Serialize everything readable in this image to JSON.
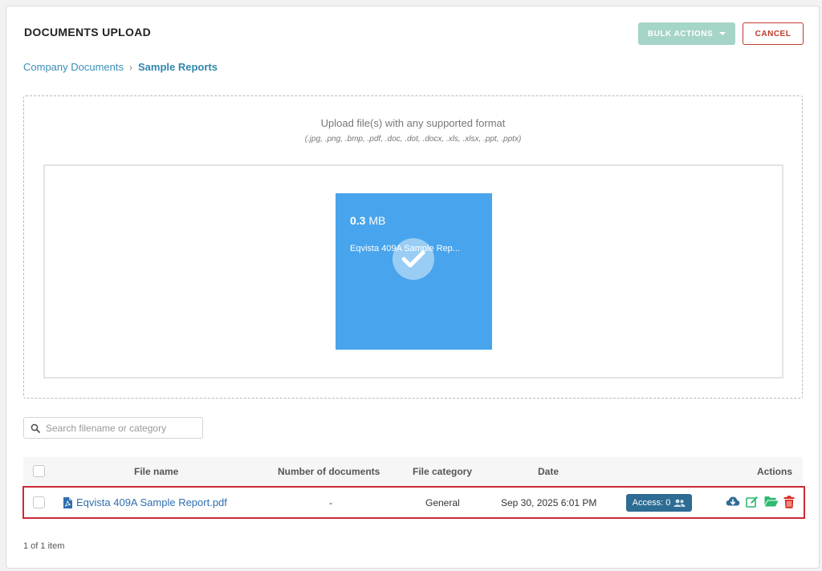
{
  "header": {
    "title": "DOCUMENTS UPLOAD",
    "bulk_actions_label": "BULK ACTIONS",
    "cancel_label": "CANCEL"
  },
  "breadcrumb": {
    "parent": "Company Documents",
    "current": "Sample Reports"
  },
  "dropzone": {
    "hint": "Upload file(s) with any supported format",
    "formats": "(.jpg, .png, .bmp, .pdf, .doc, .dot, .docx, .xls, .xlsx, .ppt, .pptx)",
    "preview": {
      "size_value": "0.3",
      "size_unit": "MB",
      "file_name": "Eqvista 409A Sample Rep..."
    }
  },
  "search": {
    "placeholder": "Search filename or category"
  },
  "table": {
    "columns": {
      "file_name": "File name",
      "num_documents": "Number of documents",
      "file_category": "File category",
      "date": "Date",
      "actions": "Actions"
    },
    "rows": [
      {
        "file_name": "Eqvista 409A Sample Report.pdf",
        "num_documents": "-",
        "file_category": "General",
        "date": "Sep 30, 2025 6:01 PM",
        "access_label": "Access: 0"
      }
    ]
  },
  "footer": {
    "pagination": "1 of 1 item"
  },
  "colors": {
    "accent": "#3a8fb7",
    "tile": "#48a4ec",
    "danger": "#c0392b",
    "success": "#2eb872",
    "badge": "#2d6c93"
  }
}
